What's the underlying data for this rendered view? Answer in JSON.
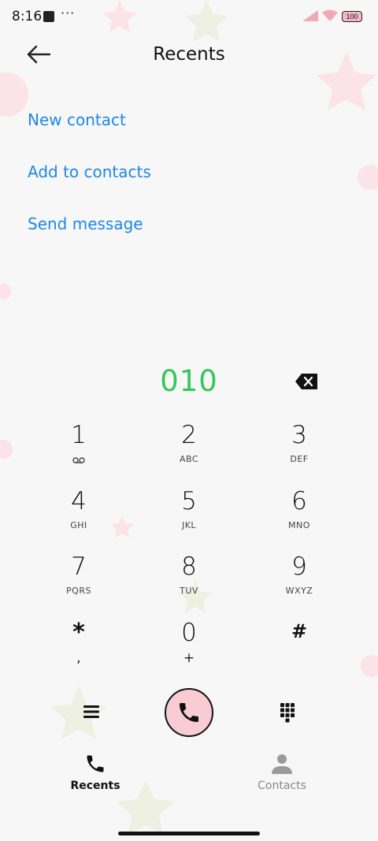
{
  "status_bar": {
    "time": "8:16",
    "more": "···",
    "battery": "100"
  },
  "header": {
    "title": "Recents"
  },
  "suggestions": {
    "new_contact": "New contact",
    "add_to_contacts": "Add to contacts",
    "send_message": "Send message"
  },
  "dialer": {
    "number": "010",
    "number_color": "#34c759",
    "keys": [
      {
        "digit": "1",
        "letters": ""
      },
      {
        "digit": "2",
        "letters": "ABC"
      },
      {
        "digit": "3",
        "letters": "DEF"
      },
      {
        "digit": "4",
        "letters": "GHI"
      },
      {
        "digit": "5",
        "letters": "JKL"
      },
      {
        "digit": "6",
        "letters": "MNO"
      },
      {
        "digit": "7",
        "letters": "PQRS"
      },
      {
        "digit": "8",
        "letters": "TUV"
      },
      {
        "digit": "9",
        "letters": "WXYZ"
      },
      {
        "digit": "*",
        "letters": ","
      },
      {
        "digit": "0",
        "letters": "+"
      },
      {
        "digit": "#",
        "letters": ""
      }
    ]
  },
  "colors": {
    "link": "#1e88e5",
    "call_button": "#f9ccd3",
    "accent_pink": "#f5b9c6"
  },
  "icons": {
    "back": "back-arrow-icon",
    "backspace": "backspace-icon",
    "menu": "menu-icon",
    "call": "phone-icon",
    "keypad": "dialpad-icon",
    "voicemail": "voicemail-icon",
    "contacts": "person-icon"
  },
  "nav": {
    "recents": "Recents",
    "contacts": "Contacts"
  }
}
